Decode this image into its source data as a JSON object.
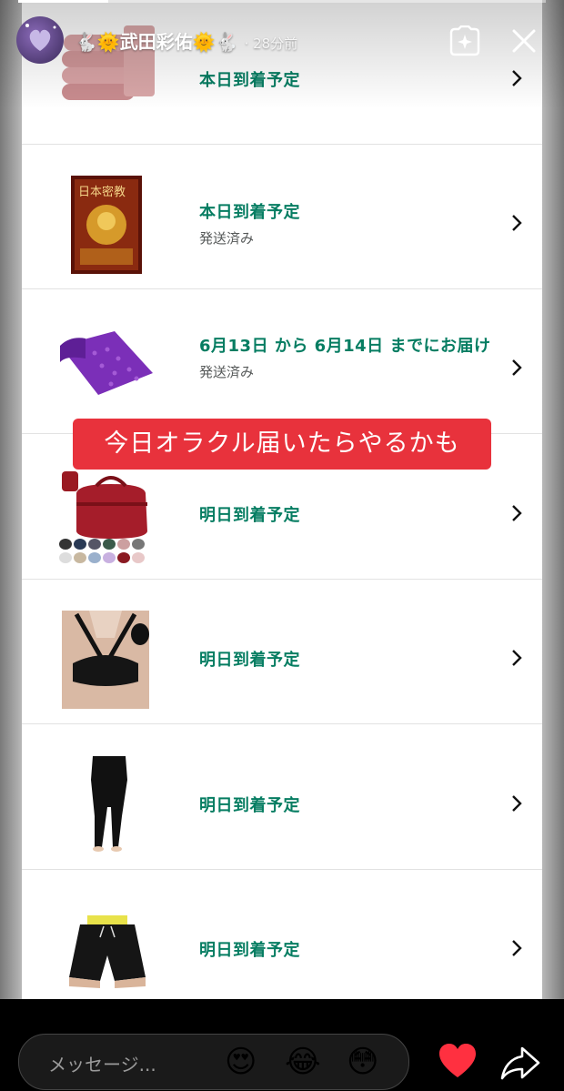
{
  "story": {
    "username": "🐇🌞武田彩佑🌞🐇",
    "time": "· 28分前",
    "progress": 0.17
  },
  "orders": [
    {
      "status": "本日到着予定",
      "sub": "",
      "product_icon": "pink-towels"
    },
    {
      "status": "本日到着予定",
      "sub": "発送済み",
      "product_icon": "oracle-card-box"
    },
    {
      "status": "6月13日 から 6月14日 までにお届け",
      "sub": "発送済み",
      "product_icon": "purple-yoga-towel"
    },
    {
      "status": "明日到着予定",
      "sub": "",
      "product_icon": "red-duffel-bag"
    },
    {
      "status": "明日到着予定",
      "sub": "",
      "product_icon": "sports-bra"
    },
    {
      "status": "明日到着予定",
      "sub": "",
      "product_icon": "black-leggings"
    },
    {
      "status": "明日到着予定",
      "sub": "",
      "product_icon": "black-shorts"
    }
  ],
  "sticker_text": "今日オラクル届いたらやるかも",
  "reply": {
    "placeholder": "メッセージ...",
    "emojis": [
      "😍",
      "😂",
      "😳"
    ]
  },
  "colors": {
    "status_green": "#067d62",
    "sticker_red": "#e8323c"
  }
}
